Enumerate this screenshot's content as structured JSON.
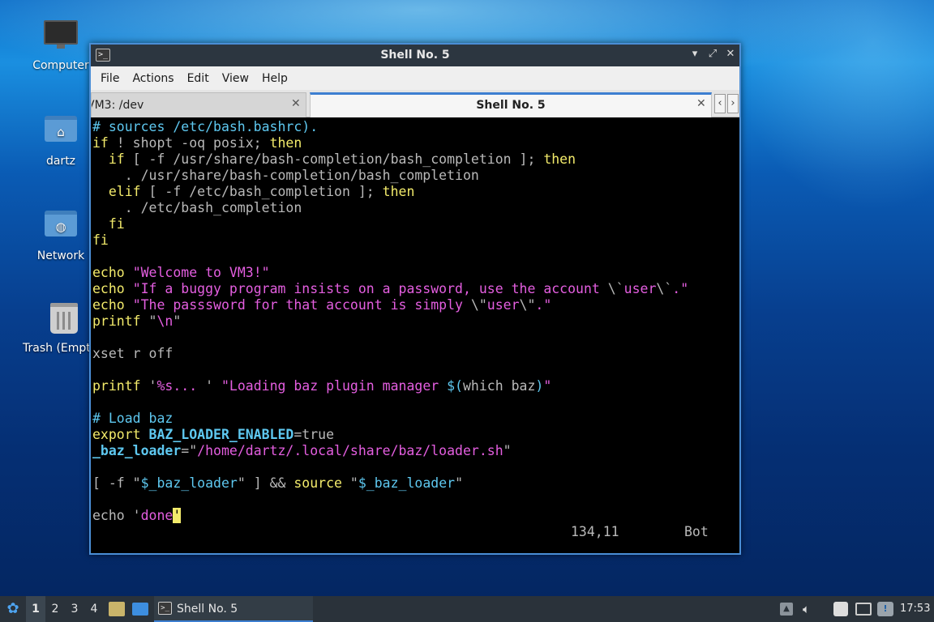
{
  "desktop": {
    "icons": [
      {
        "label": "Computer",
        "icon": "computer-icon"
      },
      {
        "label": "dartz",
        "icon": "home-folder-icon"
      },
      {
        "label": "Network",
        "icon": "network-folder-icon"
      },
      {
        "label": "Trash (Empty)",
        "icon": "trash-icon"
      }
    ]
  },
  "window": {
    "title": "Shell No. 5",
    "menu": [
      "File",
      "Actions",
      "Edit",
      "View",
      "Help"
    ],
    "tabs": [
      {
        "label": "VM3: /dev",
        "active": false
      },
      {
        "label": "Shell No. 5",
        "active": true
      }
    ]
  },
  "terminal": {
    "lines": [
      [
        [
          "c-cmt",
          "# sources /etc/bash.bashrc)."
        ]
      ],
      [
        [
          "c-kw",
          "if"
        ],
        [
          "c-txt",
          " ! shopt -oq posix; "
        ],
        [
          "c-kw",
          "then"
        ]
      ],
      [
        [
          "c-txt",
          "  "
        ],
        [
          "c-kw",
          "if"
        ],
        [
          "c-txt",
          " [ -f /usr/share/bash-completion/bash_completion ]; "
        ],
        [
          "c-kw",
          "then"
        ]
      ],
      [
        [
          "c-txt",
          "    . /usr/share/bash-completion/bash_completion"
        ]
      ],
      [
        [
          "c-txt",
          "  "
        ],
        [
          "c-kw",
          "elif"
        ],
        [
          "c-txt",
          " [ -f /etc/bash_completion ]; "
        ],
        [
          "c-kw",
          "then"
        ]
      ],
      [
        [
          "c-txt",
          "    . /etc/bash_completion"
        ]
      ],
      [
        [
          "c-txt",
          "  "
        ],
        [
          "c-kw",
          "fi"
        ]
      ],
      [
        [
          "c-kw",
          "fi"
        ]
      ],
      [],
      [
        [
          "c-kw",
          "echo"
        ],
        [
          "c-txt",
          " "
        ],
        [
          "c-str",
          "\"Welcome to VM3!\""
        ]
      ],
      [
        [
          "c-kw",
          "echo"
        ],
        [
          "c-txt",
          " "
        ],
        [
          "c-str",
          "\"If a buggy program insists on a password, use the account "
        ],
        [
          "c-txt",
          "\\`"
        ],
        [
          "c-str",
          "user"
        ],
        [
          "c-txt",
          "\\`"
        ],
        [
          "c-str",
          ".\""
        ]
      ],
      [
        [
          "c-kw",
          "echo"
        ],
        [
          "c-txt",
          " "
        ],
        [
          "c-str",
          "\"The passsword for that account is simply "
        ],
        [
          "c-txt",
          "\\\""
        ],
        [
          "c-str",
          "user"
        ],
        [
          "c-txt",
          "\\\""
        ],
        [
          "c-str",
          ".\""
        ]
      ],
      [
        [
          "c-kw",
          "printf"
        ],
        [
          "c-txt",
          " \""
        ],
        [
          "c-str",
          "\\n"
        ],
        [
          "c-txt",
          "\""
        ]
      ],
      [],
      [
        [
          "c-txt",
          "xset r off"
        ]
      ],
      [],
      [
        [
          "c-kw",
          "printf"
        ],
        [
          "c-txt",
          " '"
        ],
        [
          "c-str",
          "%s... "
        ],
        [
          "c-txt",
          "' "
        ],
        [
          "c-str",
          "\"Loading baz plugin manager "
        ],
        [
          "c-var",
          "$("
        ],
        [
          "c-txt",
          "which baz"
        ],
        [
          "c-var",
          ")"
        ],
        [
          "c-str",
          "\""
        ]
      ],
      [],
      [
        [
          "c-cmt",
          "# Load baz"
        ]
      ],
      [
        [
          "c-kw",
          "export"
        ],
        [
          "c-txt",
          " "
        ],
        [
          "c-bold",
          "BAZ_LOADER_ENABLED"
        ],
        [
          "c-txt",
          "=true"
        ]
      ],
      [
        [
          "c-bold",
          "_baz_loader"
        ],
        [
          "c-txt",
          "=\""
        ],
        [
          "c-str",
          "/home/dartz/.local/share/baz/loader.sh"
        ],
        [
          "c-txt",
          "\""
        ]
      ],
      [],
      [
        [
          "c-txt",
          "[ -f \""
        ],
        [
          "c-var",
          "$_baz_loader"
        ],
        [
          "c-txt",
          "\" ] && "
        ],
        [
          "c-kw",
          "source"
        ],
        [
          "c-txt",
          " \""
        ],
        [
          "c-var",
          "$_baz_loader"
        ],
        [
          "c-txt",
          "\""
        ]
      ],
      [],
      [
        [
          "c-txt",
          "echo '"
        ],
        [
          "c-str",
          "done"
        ],
        [
          "cursor",
          "'"
        ]
      ]
    ],
    "status_position": "134,11",
    "status_scroll": "Bot"
  },
  "taskbar": {
    "workspaces": [
      "1",
      "2",
      "3",
      "4"
    ],
    "task_label": "Shell No. 5",
    "clock": "17:53"
  }
}
